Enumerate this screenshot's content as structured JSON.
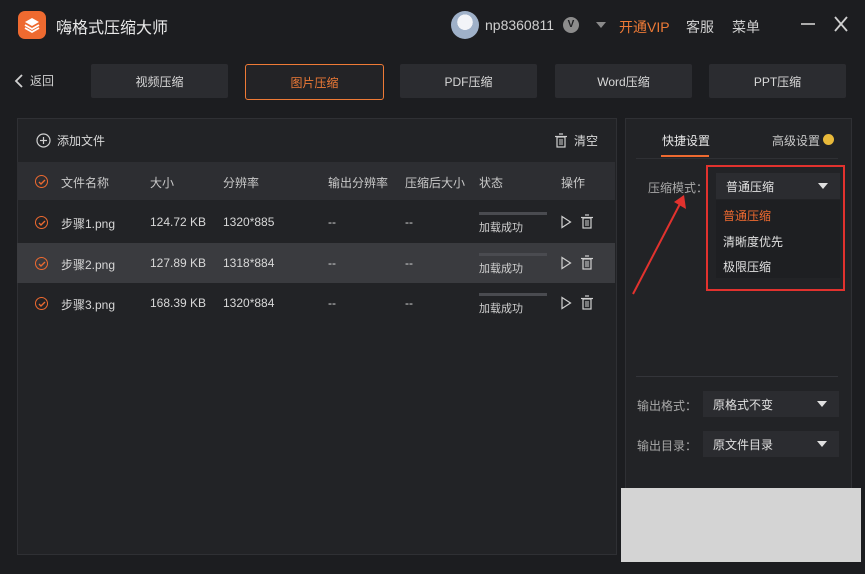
{
  "app": {
    "title": "嗨格式压缩大师"
  },
  "header": {
    "username": "np8360811",
    "badge": "V",
    "vip_label": "开通VIP",
    "service_label": "客服",
    "menu_label": "菜单"
  },
  "nav": {
    "back_label": "返回",
    "tabs": [
      {
        "label": "视频压缩"
      },
      {
        "label": "图片压缩",
        "active": true
      },
      {
        "label": "PDF压缩"
      },
      {
        "label": "Word压缩"
      },
      {
        "label": "PPT压缩"
      }
    ]
  },
  "toolbar": {
    "add_file_label": "添加文件",
    "clear_label": "清空"
  },
  "table": {
    "columns": [
      "文件名称",
      "大小",
      "分辨率",
      "输出分辨率",
      "压缩后大小",
      "状态",
      "操作"
    ],
    "rows": [
      {
        "name": "步骤1.png",
        "size": "124.72 KB",
        "resolution": "1320*885",
        "out_resolution": "--",
        "out_size": "--",
        "status": "加载成功"
      },
      {
        "name": "步骤2.png",
        "size": "127.89 KB",
        "resolution": "1318*884",
        "out_resolution": "--",
        "out_size": "--",
        "status": "加载成功"
      },
      {
        "name": "步骤3.png",
        "size": "168.39 KB",
        "resolution": "1320*884",
        "out_resolution": "--",
        "out_size": "--",
        "status": "加载成功"
      }
    ]
  },
  "settings": {
    "tabs": [
      {
        "label": "快捷设置",
        "active": true
      },
      {
        "label": "高级设置"
      }
    ],
    "mode_label": "压缩模式：",
    "mode_value": "普通压缩",
    "mode_options": [
      "普通压缩",
      "清晰度优先",
      "极限压缩"
    ],
    "format_label": "输出格式：",
    "format_value": "原格式不变",
    "dir_label": "输出目录：",
    "dir_value": "原文件目录"
  },
  "colors": {
    "accent": "#ee6a30",
    "annotation": "#e2322e",
    "background": "#1c1d20"
  }
}
